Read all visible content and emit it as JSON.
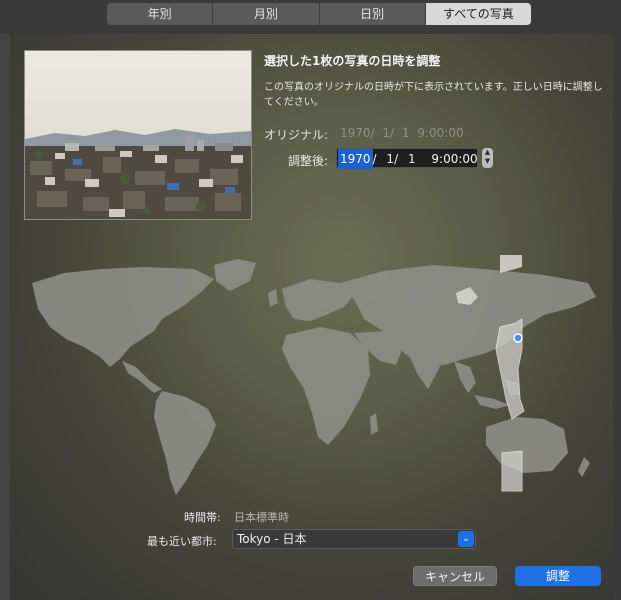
{
  "tabs": [
    "年別",
    "月別",
    "日別",
    "すべての写真"
  ],
  "active_tab": 3,
  "dialog": {
    "title": "選択した1枚の写真の日時を調整",
    "description": "この写真のオリジナルの日時が下に表示されています。正しい日時に調整してください。",
    "original_label": "オリジナル:",
    "original_value": "1970/  1/  1   9:00:00",
    "adjusted_label": "調整後:",
    "adjusted": {
      "year": "1970",
      "month": "1",
      "day": "1",
      "time": "9:00:00"
    },
    "timezone_label": "時間帯:",
    "timezone_value": "日本標準時",
    "city_label": "最も近い都市:",
    "city_value": "Tokyo - 日本",
    "cancel_label": "キャンセル",
    "ok_label": "調整"
  },
  "colors": {
    "accent": "#1f6fe5",
    "selected_text_bg": "#1b5fd1"
  },
  "icons": {
    "stepper": "stepper-icon",
    "dropdown": "chevron-down-icon",
    "location": "location-pin-icon"
  }
}
